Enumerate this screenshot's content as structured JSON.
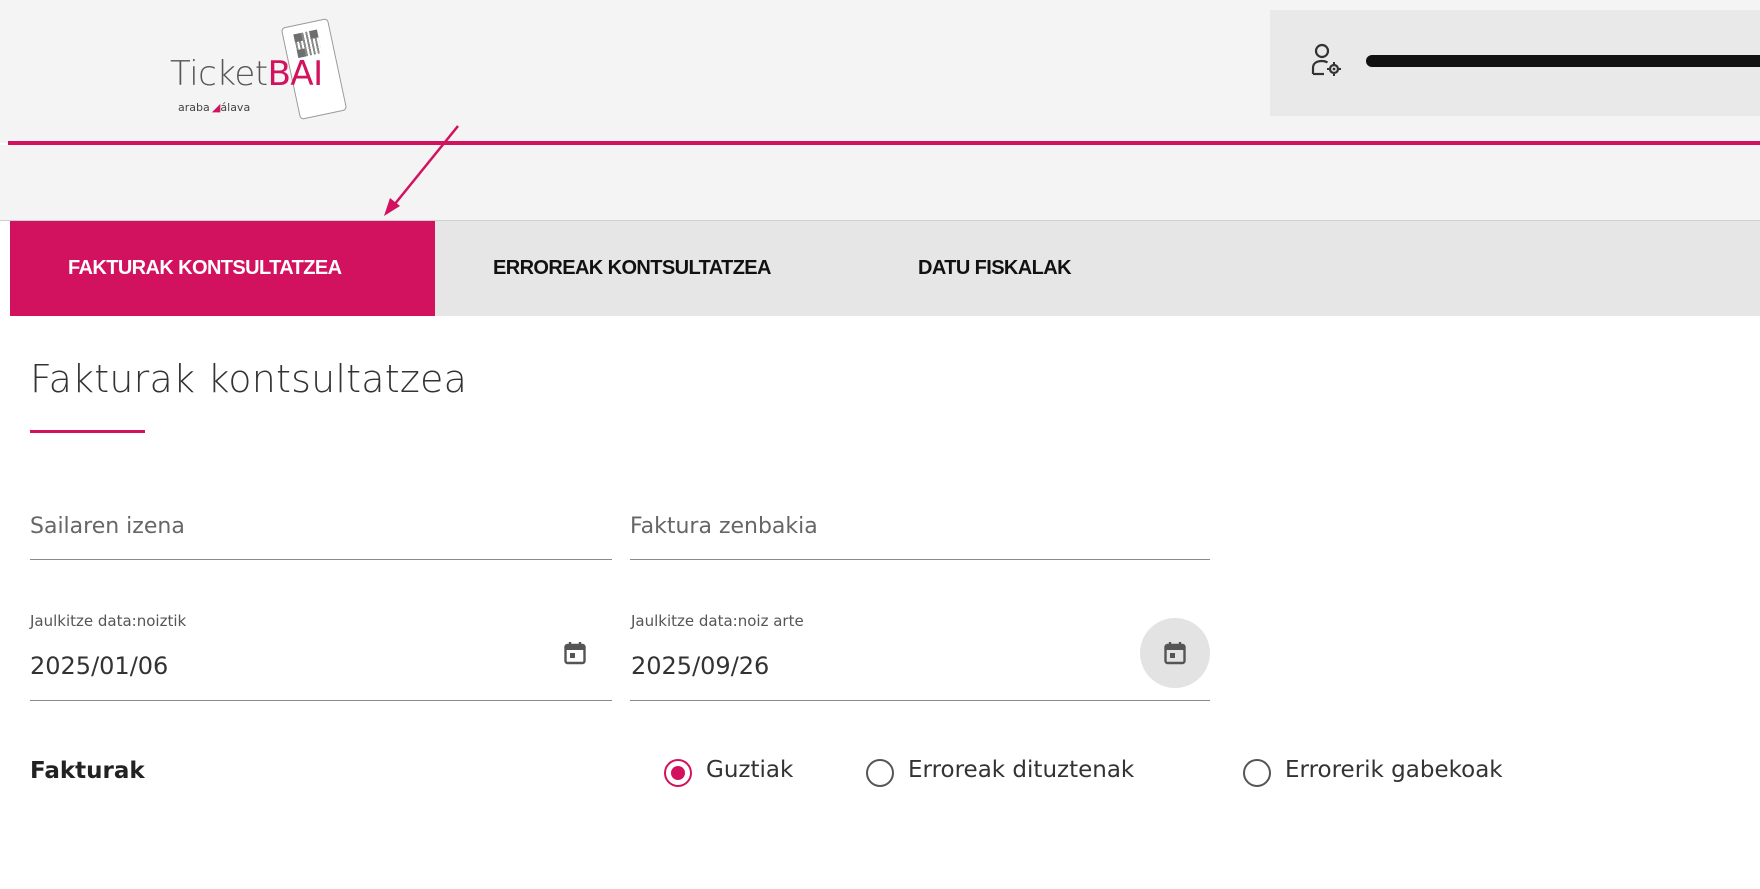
{
  "header": {
    "logo": {
      "text_main": "Ticket",
      "text_accent": "BAI",
      "subtitle_left": "araba",
      "subtitle_right": "álava"
    },
    "user": {
      "name": "████████████"
    }
  },
  "tabs": [
    {
      "label": "FAKTURAK KONTSULTATZEA",
      "active": true
    },
    {
      "label": "ERROREAK KONTSULTATZEA",
      "active": false
    },
    {
      "label": "DATU FISKALAK",
      "active": false
    }
  ],
  "page": {
    "title": "Fakturak kontsultatzea"
  },
  "filters": {
    "sailaren_izena": {
      "placeholder": "Sailaren izena",
      "value": ""
    },
    "faktura_zenbakia": {
      "placeholder": "Faktura zenbakia",
      "value": ""
    },
    "date_from": {
      "label": "Jaulkitze data:noiztik",
      "value": "2025/01/06"
    },
    "date_to": {
      "label": "Jaulkitze data:noiz arte",
      "value": "2025/09/26"
    }
  },
  "invoices_filter": {
    "label": "Fakturak",
    "options": [
      {
        "label": "Guztiak",
        "selected": true
      },
      {
        "label": "Erroreak dituztenak",
        "selected": false
      },
      {
        "label": "Errorerik gabekoak",
        "selected": false
      }
    ]
  },
  "colors": {
    "brand": "#d2125e",
    "header_bg": "#f4f4f4",
    "tabs_bg": "#e6e6e6"
  },
  "icons": [
    "user-settings-icon",
    "calendar-icon",
    "annotation-arrow"
  ]
}
